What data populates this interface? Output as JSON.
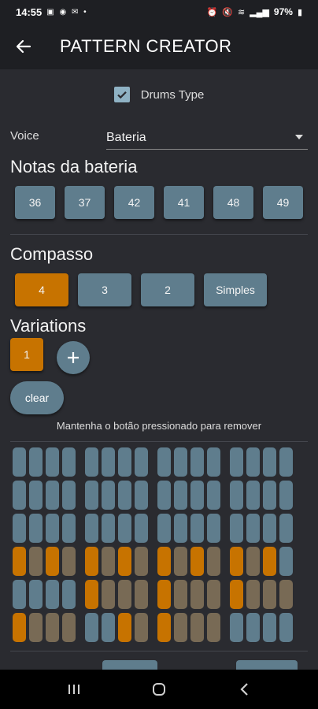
{
  "status_bar": {
    "time": "14:55",
    "battery": "97%"
  },
  "app_bar": {
    "title": "PATTERN CREATOR"
  },
  "drums_type": {
    "label": "Drums Type",
    "checked": true
  },
  "voice": {
    "label": "Voice",
    "selected": "Bateria"
  },
  "notas": {
    "title": "Notas da bateria",
    "buttons": [
      "36",
      "37",
      "42",
      "41",
      "48",
      "49"
    ]
  },
  "compasso": {
    "title": "Compasso",
    "buttons": [
      "4",
      "3",
      "2",
      "Simples"
    ],
    "selected": "4"
  },
  "variations": {
    "title": "Variations",
    "items": [
      "1"
    ],
    "add_icon": "plus-icon"
  },
  "clear": {
    "label": "clear"
  },
  "hint": "Mantenha o botão pressionado para remover",
  "grid": {
    "rows": [
      [
        0,
        0,
        0,
        0,
        0,
        0,
        0,
        0,
        0,
        0,
        0,
        0,
        0,
        0,
        0,
        0
      ],
      [
        0,
        0,
        0,
        0,
        0,
        0,
        0,
        0,
        0,
        0,
        0,
        0,
        0,
        0,
        0,
        0
      ],
      [
        0,
        0,
        0,
        0,
        0,
        0,
        0,
        0,
        0,
        0,
        0,
        0,
        0,
        0,
        0,
        0
      ],
      [
        1,
        2,
        1,
        2,
        1,
        2,
        1,
        2,
        1,
        2,
        1,
        2,
        1,
        2,
        1,
        0
      ],
      [
        0,
        0,
        0,
        0,
        1,
        2,
        2,
        2,
        1,
        2,
        2,
        2,
        1,
        2,
        2,
        2
      ],
      [
        1,
        2,
        2,
        2,
        0,
        0,
        1,
        2,
        1,
        2,
        2,
        2,
        0,
        0,
        0,
        0
      ]
    ],
    "colors": {
      "off": "#5f7d8d",
      "on": "#c77300",
      "dim": "#786a55"
    }
  },
  "colors": {
    "background": "#2a2b30",
    "accent": "#c77300",
    "button": "#5f7d8d"
  },
  "nav": {
    "recents": "recents-icon",
    "home": "home-icon",
    "back": "back-icon"
  }
}
